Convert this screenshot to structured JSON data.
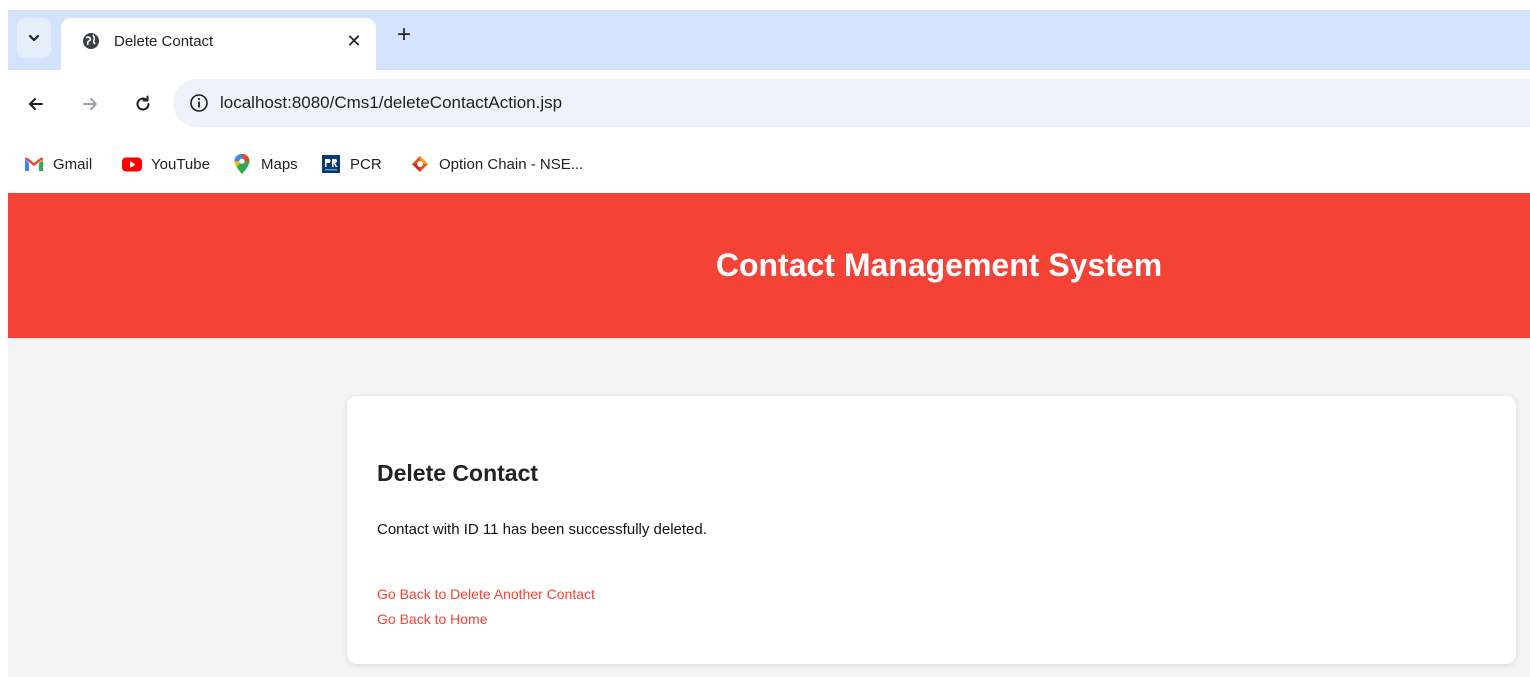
{
  "browser": {
    "tab": {
      "title": "Delete Contact",
      "close_glyph": "✕"
    },
    "new_tab_glyph": "+",
    "address_bar": {
      "url": "localhost:8080/Cms1/deleteContactAction.jsp"
    },
    "bookmarks": [
      {
        "label": "Gmail",
        "icon": "gmail-icon"
      },
      {
        "label": "YouTube",
        "icon": "youtube-icon"
      },
      {
        "label": "Maps",
        "icon": "maps-icon"
      },
      {
        "label": "PCR",
        "icon": "pcr-icon"
      },
      {
        "label": "Option Chain - NSE...",
        "icon": "nse-icon"
      }
    ]
  },
  "page": {
    "header_title": "Contact Management System",
    "card": {
      "heading": "Delete Contact",
      "message": "Contact with ID 11 has been successfully deleted.",
      "links": [
        {
          "label": "Go Back to Delete Another Contact"
        },
        {
          "label": "Go Back to Home"
        }
      ]
    }
  },
  "colors": {
    "header_red": "#f44336",
    "tabstrip_blue": "#d3e3fd",
    "link_red": "#f44336"
  }
}
